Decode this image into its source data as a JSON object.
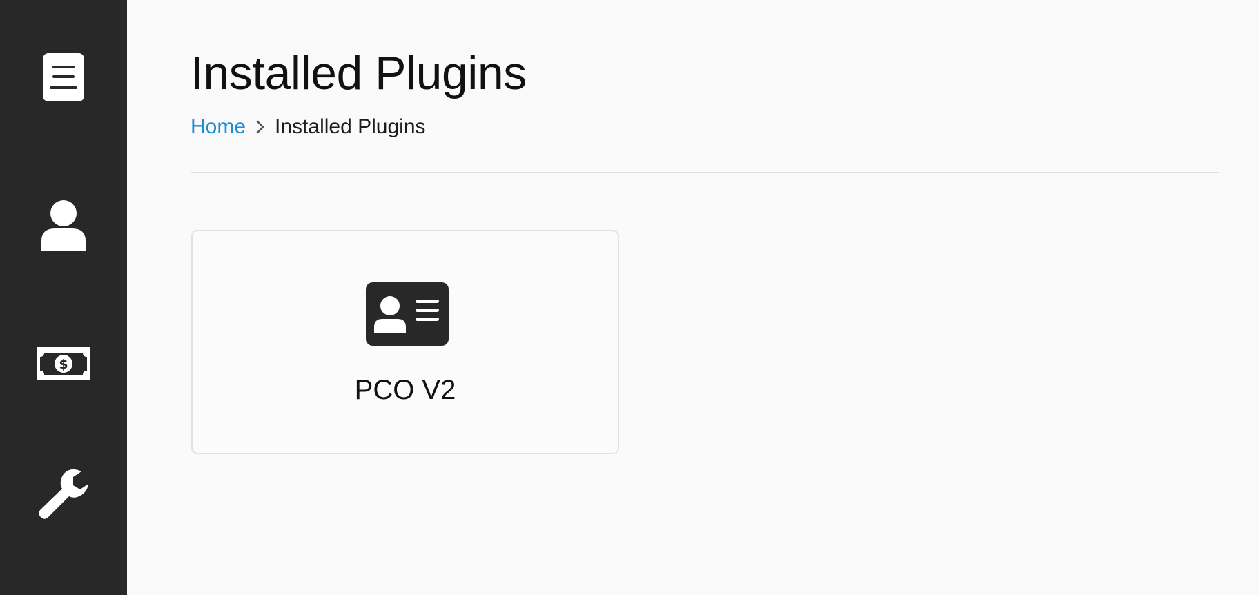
{
  "sidebar": {
    "items": [
      {
        "icon": "document-icon",
        "color": "#ffffff"
      },
      {
        "icon": "user-icon",
        "color": "#ffffff"
      },
      {
        "icon": "money-icon",
        "color": "#ffffff"
      },
      {
        "icon": "wrench-icon",
        "color": "#ffffff"
      }
    ],
    "background": "#282828"
  },
  "header": {
    "title": "Installed Plugins",
    "breadcrumb": {
      "home": "Home",
      "separator_icon": "chevron-right-icon",
      "current": "Installed Plugins"
    }
  },
  "plugins": [
    {
      "icon": "id-card-icon",
      "label": "PCO V2"
    }
  ],
  "colors": {
    "link": "#1a8bd6",
    "background": "#fafafa",
    "divider": "#e0e0e0",
    "card_border": "#e1e1e1"
  }
}
